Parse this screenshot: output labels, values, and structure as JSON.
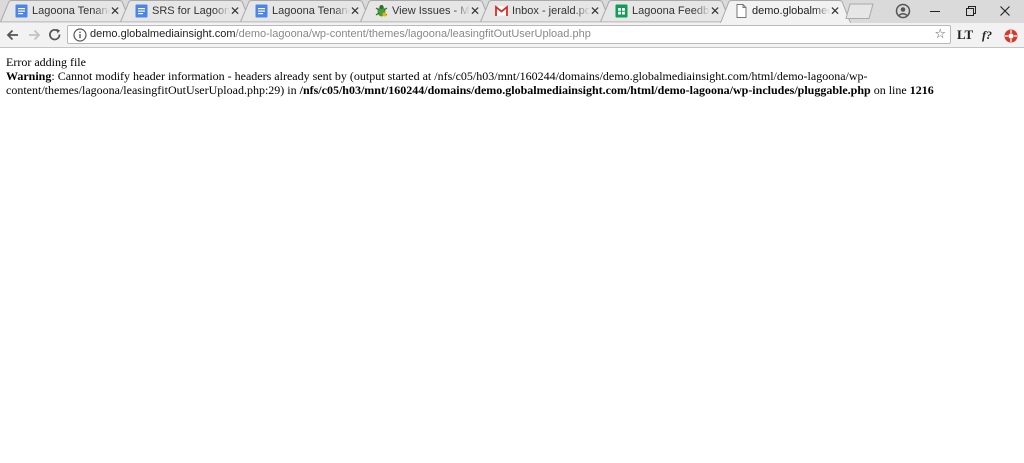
{
  "tabs": [
    {
      "title": "Lagoona Tenancy F",
      "favicon": "google-docs-icon",
      "color": "#4a86e8"
    },
    {
      "title": "SRS for Lagoona M",
      "favicon": "google-docs-icon",
      "color": "#4a86e8"
    },
    {
      "title": "Lagoona Tenancy F",
      "favicon": "google-docs-icon",
      "color": "#4a86e8"
    },
    {
      "title": "View Issues - Mant",
      "favicon": "mantis-bug-icon",
      "color": "#4a9a3e"
    },
    {
      "title": "Inbox - jerald.poul",
      "favicon": "gmail-icon",
      "color": "#d93025"
    },
    {
      "title": "Lagoona Feedback",
      "favicon": "google-sheets-icon",
      "color": "#0f9d58"
    },
    {
      "title": "demo.globalmedia",
      "favicon": "page-icon",
      "color": "#777777",
      "active": true
    }
  ],
  "address_bar": {
    "host": "demo.globalmediainsight.com",
    "path": "/demo-lagoona/wp-content/themes/lagoona/leasingfitOutUserUpload.php"
  },
  "extensions": {
    "lt_label": "LT",
    "f_label": "f?"
  },
  "page": {
    "line1": "Error adding file",
    "warning_label": "Warning",
    "warning_text": ": Cannot modify header information - headers already sent by (output started at /nfs/c05/h03/mnt/160244/domains/demo.globalmediainsight.com/html/demo-lagoona/wp-content/themes/lagoona/leasingfitOutUserUpload.php:29) in ",
    "warning_path": "/nfs/c05/h03/mnt/160244/domains/demo.globalmediainsight.com/html/demo-lagoona/wp-includes/pluggable.php",
    "on_line_text": " on line ",
    "line_number": "1216"
  },
  "colors": {
    "tabstrip": "#dadada",
    "tab_inactive": "#e6e6e6",
    "tab_active": "#f2f2f2"
  }
}
